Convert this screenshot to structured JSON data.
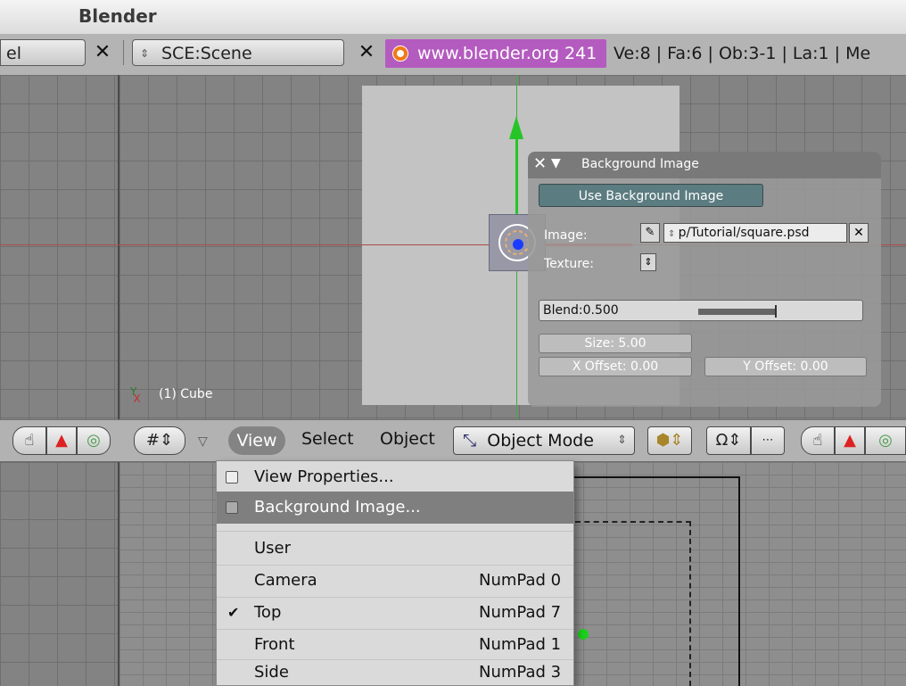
{
  "app": {
    "title": "Blender"
  },
  "info_header": {
    "screen_field": "el",
    "scene_field": "SCE:Scene",
    "blender_link": "www.blender.org 241",
    "stats": "Ve:8 | Fa:6 | Ob:3-1 | La:1 | Me"
  },
  "viewport": {
    "object_label": "(1) Cube",
    "axis_y": "Y",
    "axis_x": "X"
  },
  "bg_panel": {
    "title": "Background Image",
    "use_button": "Use Background Image",
    "image_label": "Image:",
    "image_path": "p/Tutorial/square.psd",
    "texture_label": "Texture:",
    "blend_label": "Blend:0.500",
    "blend_value": 0.5,
    "size_label": "Size: 5.00",
    "x_offset_label": "X Offset: 0.00",
    "y_offset_label": "Y Offset: 0.00"
  },
  "view_header": {
    "menus": [
      "View",
      "Select",
      "Object"
    ],
    "mode": "Object Mode"
  },
  "view_menu": {
    "items": [
      {
        "label": "View Properties...",
        "shortcut": "",
        "type": "toggle"
      },
      {
        "label": "Background Image...",
        "shortcut": "",
        "type": "toggle",
        "highlighted": true
      },
      {
        "label": "User",
        "shortcut": ""
      },
      {
        "label": "Camera",
        "shortcut": "NumPad 0"
      },
      {
        "label": "Top",
        "shortcut": "NumPad 7",
        "checked": true
      },
      {
        "label": "Front",
        "shortcut": "NumPad 1"
      },
      {
        "label": "Side",
        "shortcut": "NumPad 3"
      }
    ]
  }
}
